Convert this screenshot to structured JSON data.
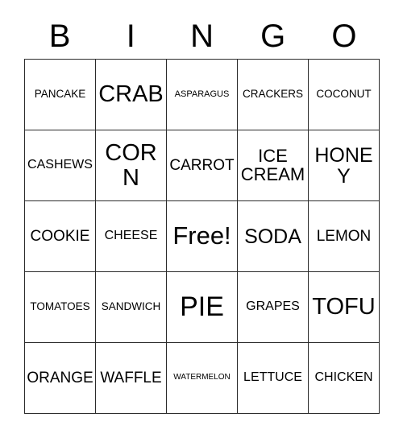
{
  "card": {
    "type": "bingo-card",
    "header_letters": [
      "B",
      "I",
      "N",
      "G",
      "O"
    ],
    "columns": 5,
    "rows": 5,
    "colors": {
      "background": "#ffffff",
      "text": "#000000",
      "border": "#2b2b2b"
    },
    "free_space": {
      "label": "Free!",
      "row": 3,
      "column": 3
    },
    "rows_data": [
      {
        "letter": "B",
        "cells": [
          {
            "label": "PANCAKE",
            "size": "xxs"
          },
          {
            "label": "CRAB",
            "size": "xl"
          },
          {
            "label": "ASPARAGUS",
            "size": "tiny"
          },
          {
            "label": "CRACKERS",
            "size": "xxs"
          },
          {
            "label": "COCONUT",
            "size": "xxs"
          }
        ]
      },
      {
        "letter": "I",
        "cells": [
          {
            "label": "CASHEWS",
            "size": "xs"
          },
          {
            "label": "CORN",
            "size": "xl"
          },
          {
            "label": "CARROT",
            "size": "sm"
          },
          {
            "label": "ICE CREAM",
            "size": "md"
          },
          {
            "label": "HONEY",
            "size": "lg"
          }
        ]
      },
      {
        "letter": "N",
        "cells": [
          {
            "label": "COOKIE",
            "size": "sm"
          },
          {
            "label": "CHEESE",
            "size": "xs"
          },
          {
            "label": "Free!",
            "size": "free"
          },
          {
            "label": "SODA",
            "size": "lg"
          },
          {
            "label": "LEMON",
            "size": "sm"
          }
        ]
      },
      {
        "letter": "G",
        "cells": [
          {
            "label": "TOMATOES",
            "size": "xxs"
          },
          {
            "label": "SANDWICH",
            "size": "xxs"
          },
          {
            "label": "PIE",
            "size": "xxl"
          },
          {
            "label": "GRAPES",
            "size": "xs"
          },
          {
            "label": "TOFU",
            "size": "xl"
          }
        ]
      },
      {
        "letter": "O",
        "cells": [
          {
            "label": "ORANGE",
            "size": "sm"
          },
          {
            "label": "WAFFLE",
            "size": "sm"
          },
          {
            "label": "WATERMELON",
            "size": "micro"
          },
          {
            "label": "LETTUCE",
            "size": "xs"
          },
          {
            "label": "CHICKEN",
            "size": "xs"
          }
        ]
      }
    ]
  }
}
